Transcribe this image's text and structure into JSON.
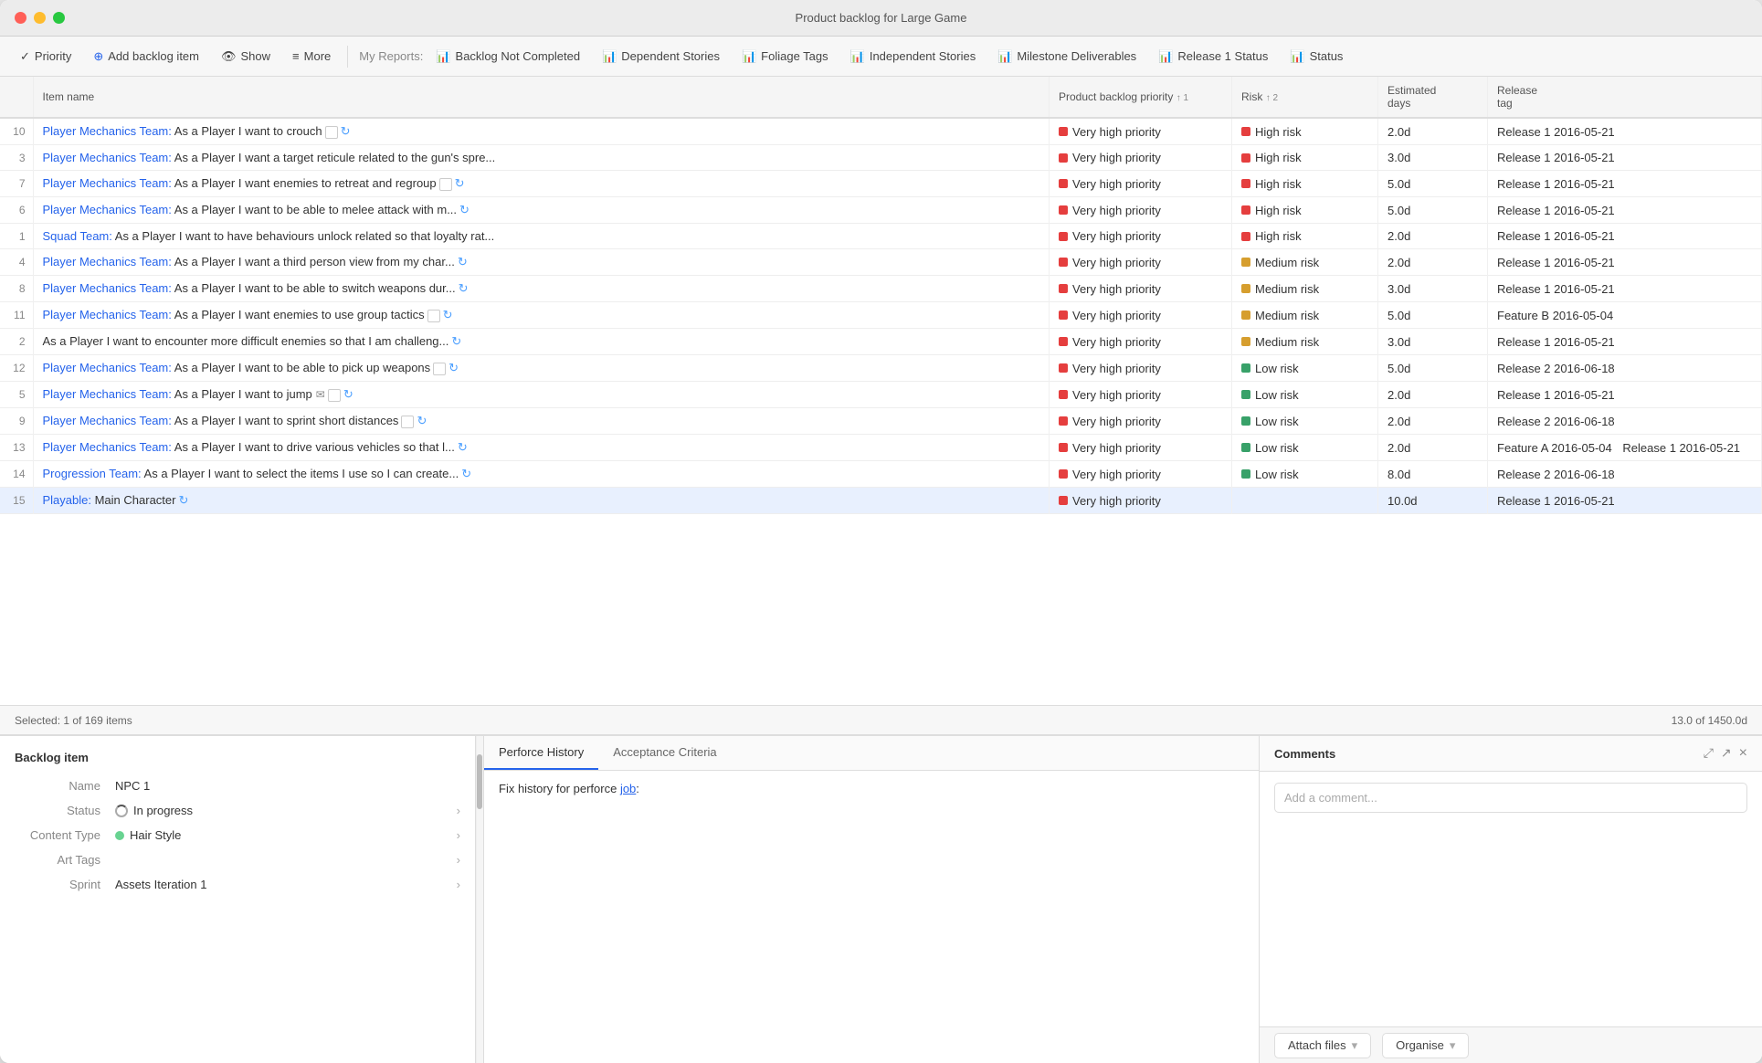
{
  "window": {
    "title": "Product backlog for Large Game",
    "traffic_lights": [
      "red",
      "yellow",
      "green"
    ]
  },
  "toolbar": {
    "priority_label": "Priority",
    "add_label": "Add backlog item",
    "show_label": "Show",
    "more_label": "More",
    "my_reports_label": "My Reports:",
    "reports": [
      {
        "label": "Backlog Not Completed"
      },
      {
        "label": "Dependent Stories"
      },
      {
        "label": "Foliage Tags"
      },
      {
        "label": "Independent Stories"
      },
      {
        "label": "Milestone Deliverables"
      },
      {
        "label": "Release 1 Status"
      },
      {
        "label": "Status"
      }
    ]
  },
  "table": {
    "columns": [
      {
        "key": "num",
        "label": ""
      },
      {
        "key": "name",
        "label": "Item name"
      },
      {
        "key": "priority",
        "label": "Product backlog priority",
        "sort": "1"
      },
      {
        "key": "risk",
        "label": "Risk",
        "sort": "2"
      },
      {
        "key": "days",
        "label": "Estimated days"
      },
      {
        "key": "release",
        "label": "Release tag"
      }
    ],
    "rows": [
      {
        "num": "10",
        "team": "Player Mechanics Team:",
        "name": " As a Player I want to crouch",
        "has_check": true,
        "has_refresh": true,
        "priority": "Very high priority",
        "priority_color": "red",
        "risk": "High risk",
        "risk_color": "red",
        "days": "2.0d",
        "release": "Release 1",
        "release_date": "2016-05-21",
        "release2": "",
        "release2_date": ""
      },
      {
        "num": "3",
        "team": "Player Mechanics Team:",
        "name": " As a Player I want a target reticule related to the gun's spre...",
        "has_check": false,
        "has_refresh": false,
        "priority": "Very high priority",
        "priority_color": "red",
        "risk": "High risk",
        "risk_color": "red",
        "days": "3.0d",
        "release": "Release 1",
        "release_date": "2016-05-21",
        "release2": "",
        "release2_date": ""
      },
      {
        "num": "7",
        "team": "Player Mechanics Team:",
        "name": " As a Player I want enemies to retreat and regroup",
        "has_check": true,
        "has_refresh": true,
        "priority": "Very high priority",
        "priority_color": "red",
        "risk": "High risk",
        "risk_color": "red",
        "days": "5.0d",
        "release": "Release 1",
        "release_date": "2016-05-21",
        "release2": "",
        "release2_date": ""
      },
      {
        "num": "6",
        "team": "Player Mechanics Team:",
        "name": " As a Player I want to be able to melee attack with m...",
        "has_check": false,
        "has_refresh": true,
        "priority": "Very high priority",
        "priority_color": "red",
        "risk": "High risk",
        "risk_color": "red",
        "days": "5.0d",
        "release": "Release 1",
        "release_date": "2016-05-21",
        "release2": "",
        "release2_date": ""
      },
      {
        "num": "1",
        "team": "Squad Team:",
        "name": " As a Player I want to have behaviours unlock related so that loyalty rat...",
        "has_check": false,
        "has_refresh": false,
        "priority": "Very high priority",
        "priority_color": "red",
        "risk": "High risk",
        "risk_color": "red",
        "days": "2.0d",
        "release": "Release 1",
        "release_date": "2016-05-21",
        "release2": "",
        "release2_date": ""
      },
      {
        "num": "4",
        "team": "Player Mechanics Team:",
        "name": " As a Player I want a third person view from my char...",
        "has_check": false,
        "has_refresh": true,
        "priority": "Very high priority",
        "priority_color": "red",
        "risk": "Medium risk",
        "risk_color": "yellow",
        "days": "2.0d",
        "release": "Release 1",
        "release_date": "2016-05-21",
        "release2": "",
        "release2_date": ""
      },
      {
        "num": "8",
        "team": "Player Mechanics Team:",
        "name": " As a Player I want to be able to switch weapons dur...",
        "has_check": false,
        "has_refresh": true,
        "priority": "Very high priority",
        "priority_color": "red",
        "risk": "Medium risk",
        "risk_color": "yellow",
        "days": "3.0d",
        "release": "Release 1",
        "release_date": "2016-05-21",
        "release2": "",
        "release2_date": ""
      },
      {
        "num": "11",
        "team": "Player Mechanics Team:",
        "name": " As a Player I want enemies to use group tactics",
        "has_check": true,
        "has_refresh": true,
        "priority": "Very high priority",
        "priority_color": "red",
        "risk": "Medium risk",
        "risk_color": "yellow",
        "days": "5.0d",
        "release": "Feature B",
        "release_date": "2016-05-04",
        "release2": "",
        "release2_date": ""
      },
      {
        "num": "2",
        "team": "",
        "name": "As a Player I want to encounter more difficult enemies so that I am challeng...",
        "has_check": false,
        "has_refresh": true,
        "priority": "Very high priority",
        "priority_color": "red",
        "risk": "Medium risk",
        "risk_color": "yellow",
        "days": "3.0d",
        "release": "Release 1",
        "release_date": "2016-05-21",
        "release2": "",
        "release2_date": ""
      },
      {
        "num": "12",
        "team": "Player Mechanics Team:",
        "name": " As a Player I want to be able to pick up weapons",
        "has_check": true,
        "has_refresh": true,
        "priority": "Very high priority",
        "priority_color": "red",
        "risk": "Low risk",
        "risk_color": "green",
        "days": "5.0d",
        "release": "Release 2",
        "release_date": "2016-06-18",
        "release2": "",
        "release2_date": ""
      },
      {
        "num": "5",
        "team": "Player Mechanics Team:",
        "name": " As a Player I want to jump",
        "has_check": true,
        "has_refresh": true,
        "priority": "Very high priority",
        "priority_color": "red",
        "risk": "Low risk",
        "risk_color": "green",
        "days": "2.0d",
        "release": "Release 1",
        "release_date": "2016-05-21",
        "release2": "",
        "release2_date": ""
      },
      {
        "num": "9",
        "team": "Player Mechanics Team:",
        "name": " As a Player I want to sprint short distances",
        "has_check": true,
        "has_refresh": true,
        "priority": "Very high priority",
        "priority_color": "red",
        "risk": "Low risk",
        "risk_color": "green",
        "days": "2.0d",
        "release": "Release 2",
        "release_date": "2016-06-18",
        "release2": "",
        "release2_date": ""
      },
      {
        "num": "13",
        "team": "Player Mechanics Team:",
        "name": " As a Player I want to drive various vehicles so that l...",
        "has_check": false,
        "has_refresh": true,
        "priority": "Very high priority",
        "priority_color": "red",
        "risk": "Low risk",
        "risk_color": "green",
        "days": "2.0d",
        "release": "Feature A",
        "release_date": "2016-05-04",
        "release2": "Release 1",
        "release2_date": "2016-05-21"
      },
      {
        "num": "14",
        "team": "Progression Team:",
        "name": " As a Player I want to select the items I use so I can create...",
        "has_check": false,
        "has_refresh": true,
        "priority": "Very high priority",
        "priority_color": "red",
        "risk": "Low risk",
        "risk_color": "green",
        "days": "8.0d",
        "release": "Release 2",
        "release_date": "2016-06-18",
        "release2": "",
        "release2_date": ""
      },
      {
        "num": "15",
        "team": "Playable:",
        "name": " Main Character",
        "has_check": false,
        "has_refresh": true,
        "priority": "Very high priority",
        "priority_color": "red",
        "risk": "",
        "risk_color": "",
        "days": "10.0d",
        "release": "Release 1",
        "release_date": "2016-05-21",
        "release2": "",
        "release2_date": ""
      }
    ]
  },
  "statusbar": {
    "selected": "Selected: 1 of 169 items",
    "total": "13.0 of 1450.0d"
  },
  "detail": {
    "title": "Backlog item",
    "fields": [
      {
        "label": "Name",
        "value": "NPC 1",
        "has_chevron": false
      },
      {
        "label": "Status",
        "value": "In progress",
        "has_chevron": true,
        "has_icon": true
      },
      {
        "label": "Content Type",
        "value": "Hair Style",
        "has_chevron": true,
        "has_dot": true
      },
      {
        "label": "Art Tags",
        "value": "",
        "has_chevron": true
      },
      {
        "label": "Sprint",
        "value": "Assets Iteration 1",
        "has_chevron": true
      }
    ]
  },
  "tabs": {
    "items": [
      {
        "label": "Perforce History",
        "active": true
      },
      {
        "label": "Acceptance Criteria",
        "active": false
      }
    ],
    "content": "Fix history for perforce job:"
  },
  "comments": {
    "title": "Comments",
    "placeholder": "Add a comment...",
    "actions": [
      "expand",
      "external",
      "close"
    ]
  },
  "footer": {
    "attach_label": "Attach files",
    "organise_label": "Organise"
  }
}
